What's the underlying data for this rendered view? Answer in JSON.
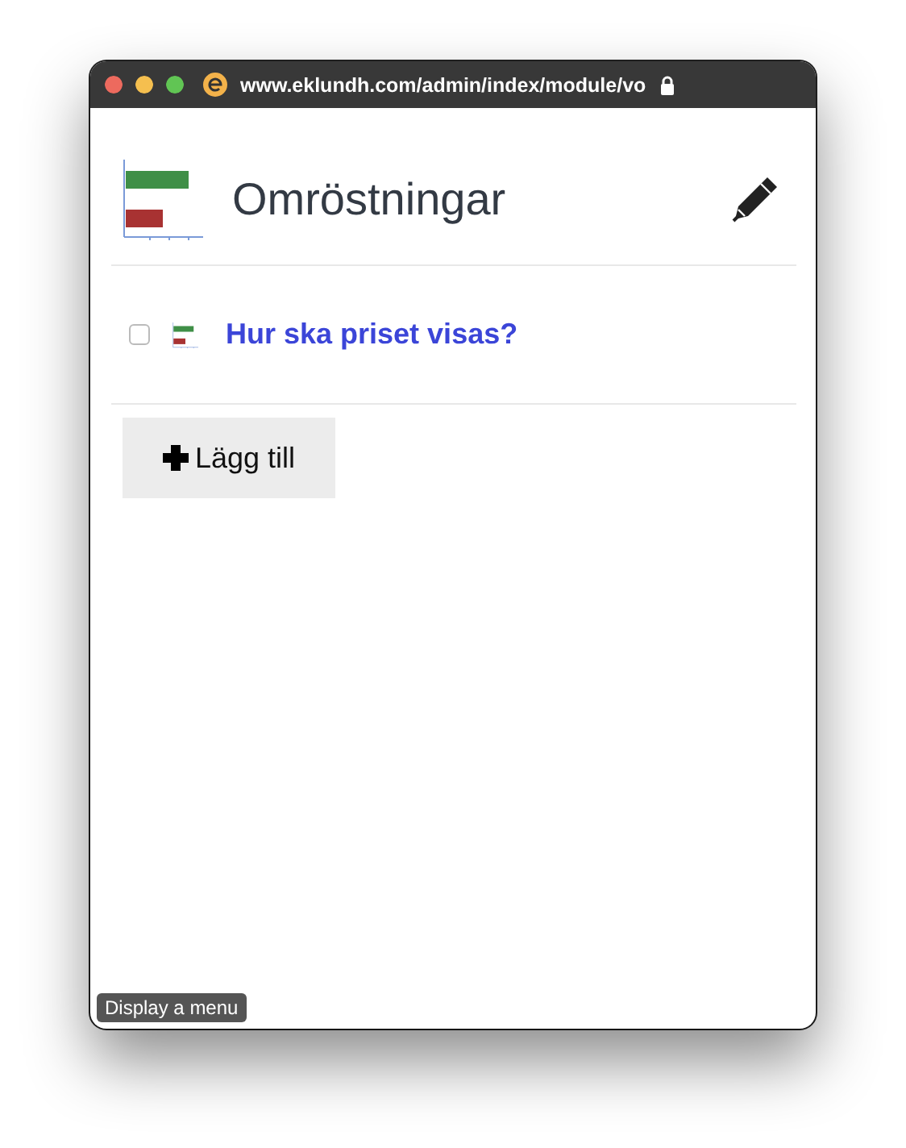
{
  "browser": {
    "url": "www.eklundh.com/admin/index/module/vo"
  },
  "page": {
    "title": "Omröstningar"
  },
  "polls": [
    {
      "title": "Hur ska priset visas?",
      "checked": false
    }
  ],
  "add_button": {
    "label": "Lägg till"
  },
  "tooltip": {
    "text": "Display a menu"
  }
}
